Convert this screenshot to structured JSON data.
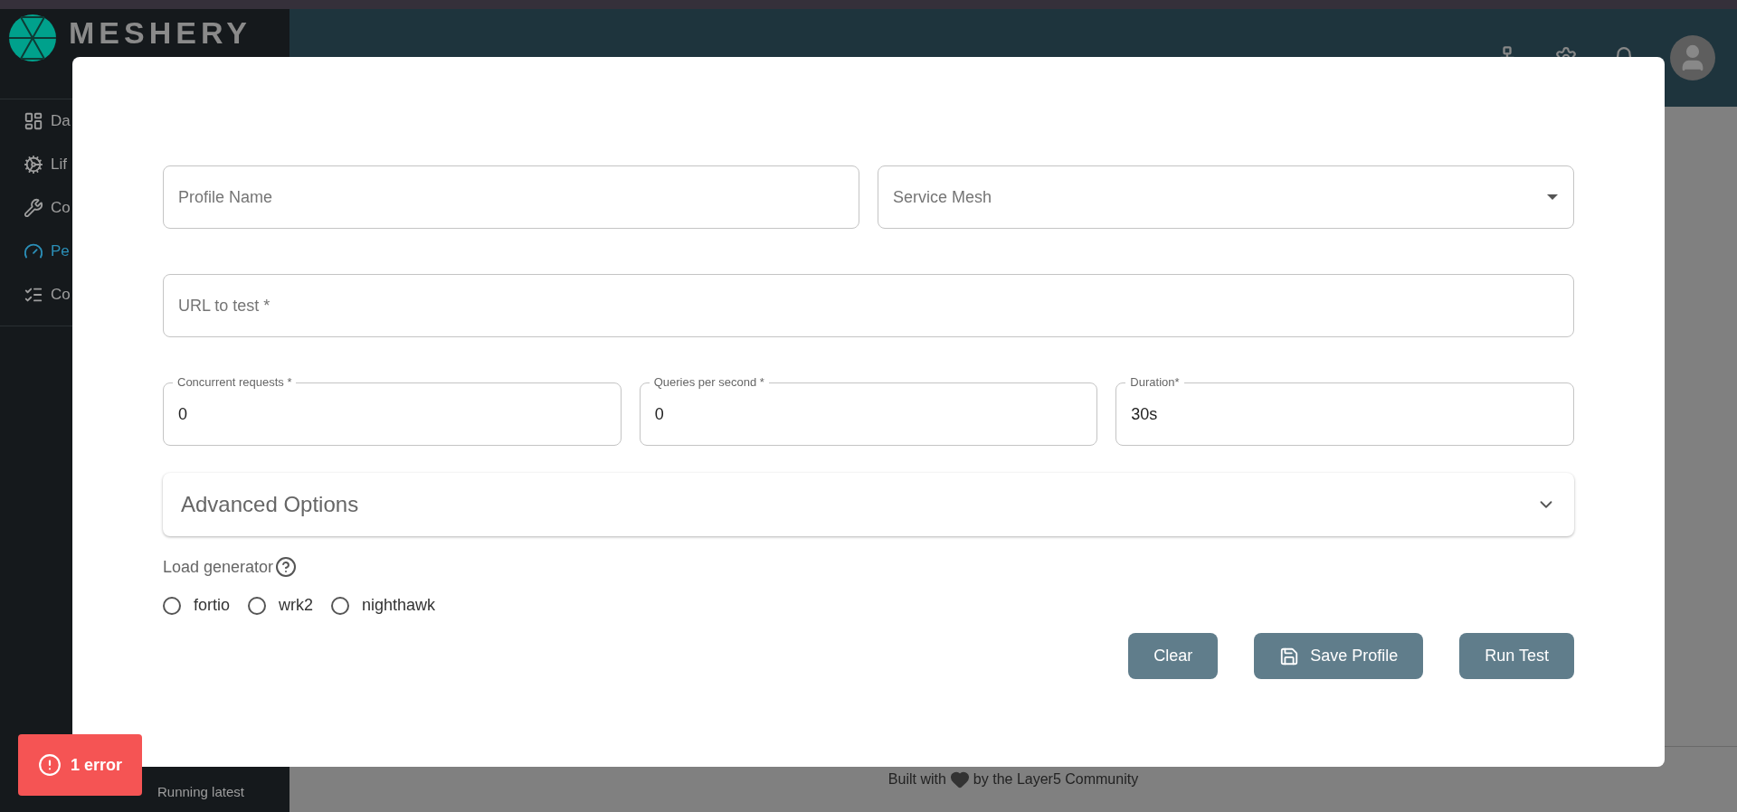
{
  "sidebar": {
    "logo_text": "MESHERY",
    "items": [
      {
        "kind": "dashboard",
        "label": "Da",
        "selected": false
      },
      {
        "kind": "lifecycle",
        "label": "Lif",
        "selected": false
      },
      {
        "kind": "configuration",
        "label": "Co",
        "selected": false
      },
      {
        "kind": "performance",
        "label": "Pe",
        "selected": true
      },
      {
        "kind": "conformance",
        "label": "Co",
        "selected": false
      }
    ],
    "version": "Running latest"
  },
  "dialog": {
    "rows": [
      [
        {
          "kind": "text",
          "placeholder": "Profile Name"
        },
        {
          "kind": "select",
          "placeholder": "Service Mesh"
        }
      ],
      [
        {
          "kind": "text",
          "placeholder": "URL to test *"
        }
      ],
      [
        {
          "kind": "text",
          "label": "Concurrent requests *",
          "value": "0"
        },
        {
          "kind": "text",
          "label": "Queries per second *",
          "value": "0"
        },
        {
          "kind": "text",
          "label": "Duration*",
          "value": "30s"
        }
      ]
    ],
    "advanced": {
      "title": "Advanced Options",
      "expanded": false
    },
    "load_generator": {
      "label": "Load generator",
      "options": [
        {
          "label": "fortio",
          "selected": false
        },
        {
          "label": "wrk2",
          "selected": false
        },
        {
          "label": "nighthawk",
          "selected": false
        }
      ]
    },
    "buttons": [
      {
        "kind": "plain",
        "label": "Clear"
      },
      {
        "kind": "save",
        "label": "Save Profile"
      },
      {
        "kind": "plain",
        "label": "Run Test"
      }
    ]
  },
  "footer": {
    "before": "Built with",
    "after": "by the Layer5 Community"
  },
  "toast": {
    "text": "1 error"
  }
}
